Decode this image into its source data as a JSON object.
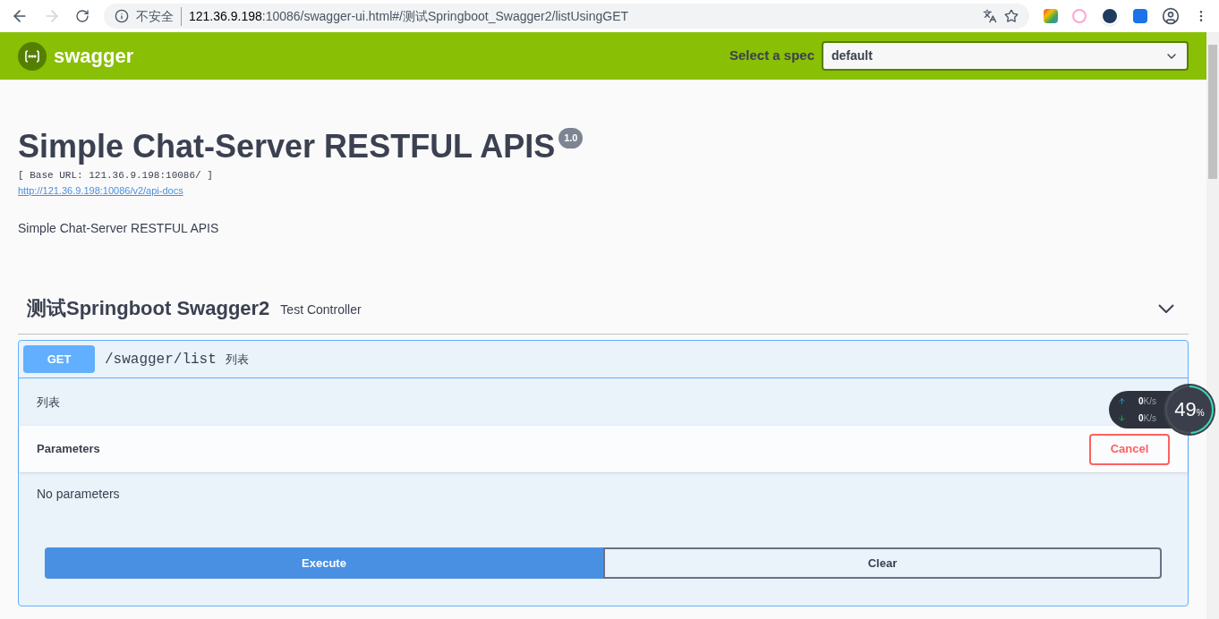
{
  "browser": {
    "security": "不安全",
    "url_host": "121.36.9.198",
    "url_rest": ":10086/swagger-ui.html#/测试Springboot_Swagger2/listUsingGET"
  },
  "topbar": {
    "logo_text": "swagger",
    "spec_label": "Select a spec",
    "spec_value": "default"
  },
  "info": {
    "title": "Simple Chat-Server RESTFUL APIS",
    "version": "1.0",
    "base_url": "[ Base URL: 121.36.9.198:10086/ ]",
    "docs_link": "http://121.36.9.198:10086/v2/api-docs",
    "description": "Simple Chat-Server RESTFUL APIS"
  },
  "tag": {
    "name": "测试Springboot Swagger2",
    "description": "Test Controller",
    "expanded": true
  },
  "operation": {
    "method": "GET",
    "path": "/swagger/list",
    "summary": "列表",
    "description": "列表",
    "parameters_title": "Parameters",
    "cancel": "Cancel",
    "no_params": "No parameters",
    "execute": "Execute",
    "clear": "Clear"
  },
  "net_widget": {
    "up": "0",
    "up_unit": "K/s",
    "down": "0",
    "down_unit": "K/s",
    "percent": "49",
    "percent_sign": "%",
    "level": 0.49
  }
}
